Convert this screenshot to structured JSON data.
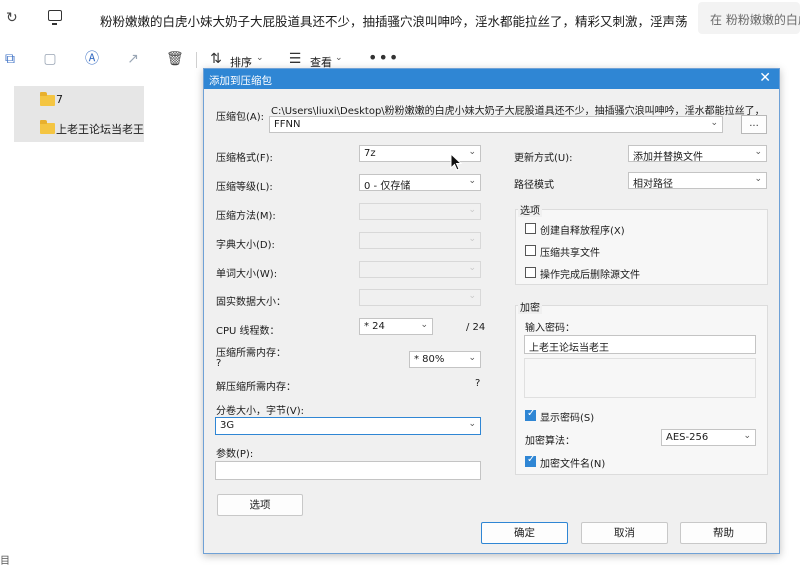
{
  "explorer": {
    "address_path": "粉粉嫩嫩的白虎小妹大奶子大屁股道具还不少，抽插骚穴浪叫呻吟，淫水都能拉丝了，精彩又刺激，淫声荡",
    "search_placeholder": "在 粉粉嫩嫩的白虎小",
    "toolbar": {
      "sort_label": "排序",
      "view_label": "查看",
      "more_label": "•••"
    },
    "files": [
      {
        "name": "7"
      },
      {
        "name": "上老王论坛当老王"
      }
    ],
    "corner_glyph": "目"
  },
  "dialog": {
    "title": "添加到压缩包",
    "close_label": "✕",
    "archive_label": "压缩包(A):",
    "archive_path": "C:\\Users\\liuxi\\Desktop\\粉粉嫩嫩的白虎小妹大奶子大屁股道具还不少，抽插骚穴浪叫呻吟，淫水都能拉丝了，",
    "archive_name": "FFNN",
    "browse_label": "...",
    "left": {
      "format_label": "压缩格式(F):",
      "format_value": "7z",
      "level_label": "压缩等级(L):",
      "level_value": "0 - 仅存储",
      "method_label": "压缩方法(M):",
      "dict_label": "字典大小(D):",
      "word_label": "单词大小(W):",
      "solid_label": "固实数据大小：",
      "cpu_label": "CPU 线程数：",
      "cpu_value": "* 24",
      "cpu_max": "/ 24",
      "mem_comp_label": "压缩所需内存：",
      "mem_comp_value": "?",
      "mem_percent": "* 80%",
      "mem_decomp_label": "解压缩所需内存：",
      "mem_decomp_value": "?",
      "volume_label": "分卷大小，字节(V):",
      "volume_value": "3G",
      "params_label": "参数(P):",
      "options_button": "选项"
    },
    "right": {
      "update_label": "更新方式(U):",
      "update_value": "添加并替换文件",
      "pathmode_label": "路径模式",
      "pathmode_value": "相对路径",
      "options_group": "选项",
      "opt_sfx": "创建自释放程序(X)",
      "opt_shared": "压缩共享文件",
      "opt_delete": "操作完成后删除源文件",
      "encrypt_group": "加密",
      "password_label": "输入密码：",
      "password_value": "上老王论坛当老王",
      "show_password": "显示密码(S)",
      "enc_method_label": "加密算法：",
      "enc_method_value": "AES-256",
      "encrypt_names": "加密文件名(N)"
    },
    "buttons": {
      "ok": "确定",
      "cancel": "取消",
      "help": "帮助"
    }
  }
}
